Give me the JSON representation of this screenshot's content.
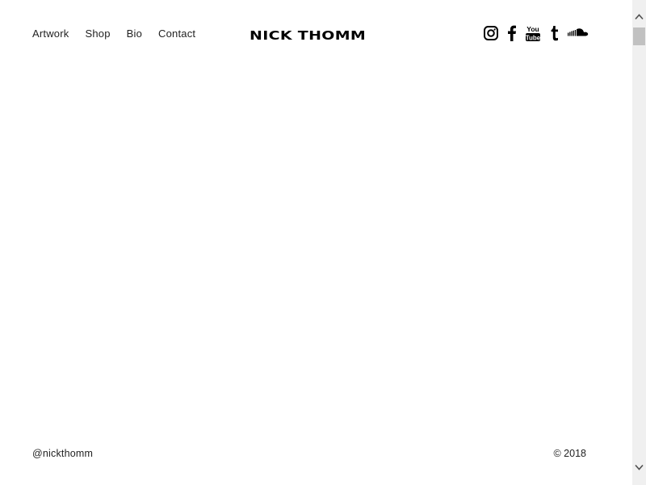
{
  "nav": {
    "items": [
      {
        "label": "Artwork"
      },
      {
        "label": "Shop"
      },
      {
        "label": "Bio"
      },
      {
        "label": "Contact"
      }
    ]
  },
  "logo": {
    "text": "NICK THOMM"
  },
  "social": {
    "icons": [
      "instagram-icon",
      "facebook-icon",
      "youtube-icon",
      "tumblr-icon",
      "soundcloud-icon"
    ],
    "youtube_text": {
      "top": "You",
      "bottom": "Tube"
    }
  },
  "footer": {
    "handle": "@nickthomm",
    "copyright": "© 2018"
  },
  "colors": {
    "text": "#111111",
    "background": "#ffffff",
    "scrollbar_track": "#f0f0f0",
    "scrollbar_thumb": "#c1c1c1"
  }
}
